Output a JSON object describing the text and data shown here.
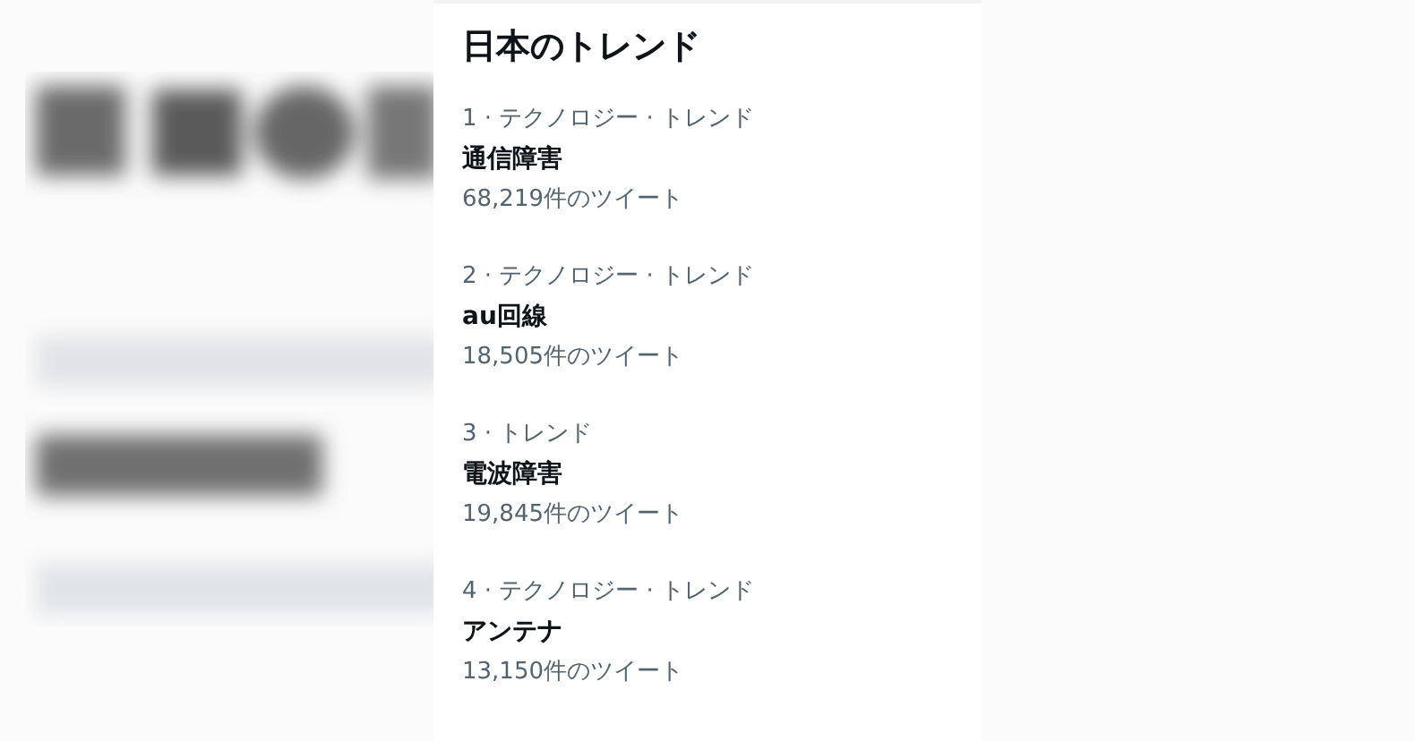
{
  "panel": {
    "title": "日本のトレンド",
    "trends": [
      {
        "context": "1 · テクノロジー · トレンド",
        "name": "通信障害",
        "count": "68,219件のツイート"
      },
      {
        "context": "2 · テクノロジー · トレンド",
        "name": "au回線",
        "count": "18,505件のツイート"
      },
      {
        "context": "3 · トレンド",
        "name": "電波障害",
        "count": "19,845件のツイート"
      },
      {
        "context": "4 · テクノロジー · トレンド",
        "name": "アンテナ",
        "count": "13,150件のツイート"
      }
    ]
  }
}
